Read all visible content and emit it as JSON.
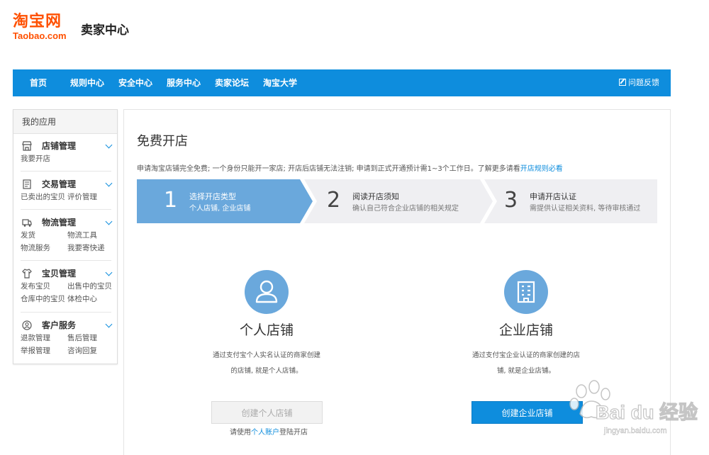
{
  "header": {
    "logo_cn": "淘宝网",
    "logo_en": "Taobao.com",
    "title": "卖家中心"
  },
  "nav": {
    "items": [
      "首页",
      "规则中心",
      "安全中心",
      "服务中心",
      "卖家论坛",
      "淘宝大学"
    ],
    "feedback": "问题反馈"
  },
  "sidebar": {
    "title": "我的应用",
    "groups": [
      {
        "title": "店铺管理",
        "icon": "store-icon",
        "links": [
          "我要开店"
        ]
      },
      {
        "title": "交易管理",
        "icon": "document-icon",
        "links": [
          "已卖出的宝贝",
          "评价管理"
        ]
      },
      {
        "title": "物流管理",
        "icon": "truck-icon",
        "links": [
          "发货",
          "物流工具",
          "物流服务",
          "我要寄快递"
        ]
      },
      {
        "title": "宝贝管理",
        "icon": "shirt-icon",
        "links": [
          "发布宝贝",
          "出售中的宝贝",
          "仓库中的宝贝",
          "体检中心"
        ]
      },
      {
        "title": "客户服务",
        "icon": "user-icon",
        "links": [
          "退款管理",
          "售后管理",
          "举报管理",
          "咨询回复"
        ]
      }
    ]
  },
  "main": {
    "title": "免费开店",
    "notice": "申请淘宝店铺完全免费; 一个身份只能开一家店; 开店后店铺无法注销; 申请到正式开通预计需1~3个工作日。了解更多请看",
    "notice_link": "开店规则必看",
    "steps": [
      {
        "num": "1",
        "title": "选择开店类型",
        "sub": "个人店铺, 企业店铺"
      },
      {
        "num": "2",
        "title": "阅读开店须知",
        "sub": "确认自己符合企业店铺的相关规定"
      },
      {
        "num": "3",
        "title": "申请开店认证",
        "sub": "需提供认证相关资料, 等待审核通过"
      }
    ],
    "personal": {
      "title": "个人店铺",
      "desc1": "通过支付宝个人实名认证的商家创建",
      "desc2": "的店铺, 就是个人店铺。",
      "button": "创建个人店铺",
      "hint_pre": "请使用",
      "hint_link": "个人账户",
      "hint_post": "登陆开店"
    },
    "enterprise": {
      "title": "企业店铺",
      "desc1": "通过支付宝企业认证的商家创建的店",
      "desc2": "铺, 就是企业店铺。",
      "button": "创建企业店铺"
    }
  },
  "watermark": {
    "text": "Bai du 经验",
    "sub": "jingyan.baidu.com"
  },
  "colors": {
    "brand": "#ff5000",
    "nav": "#0e8ddd",
    "step_active": "#6aa8dc",
    "step_inactive": "#efeff2"
  }
}
